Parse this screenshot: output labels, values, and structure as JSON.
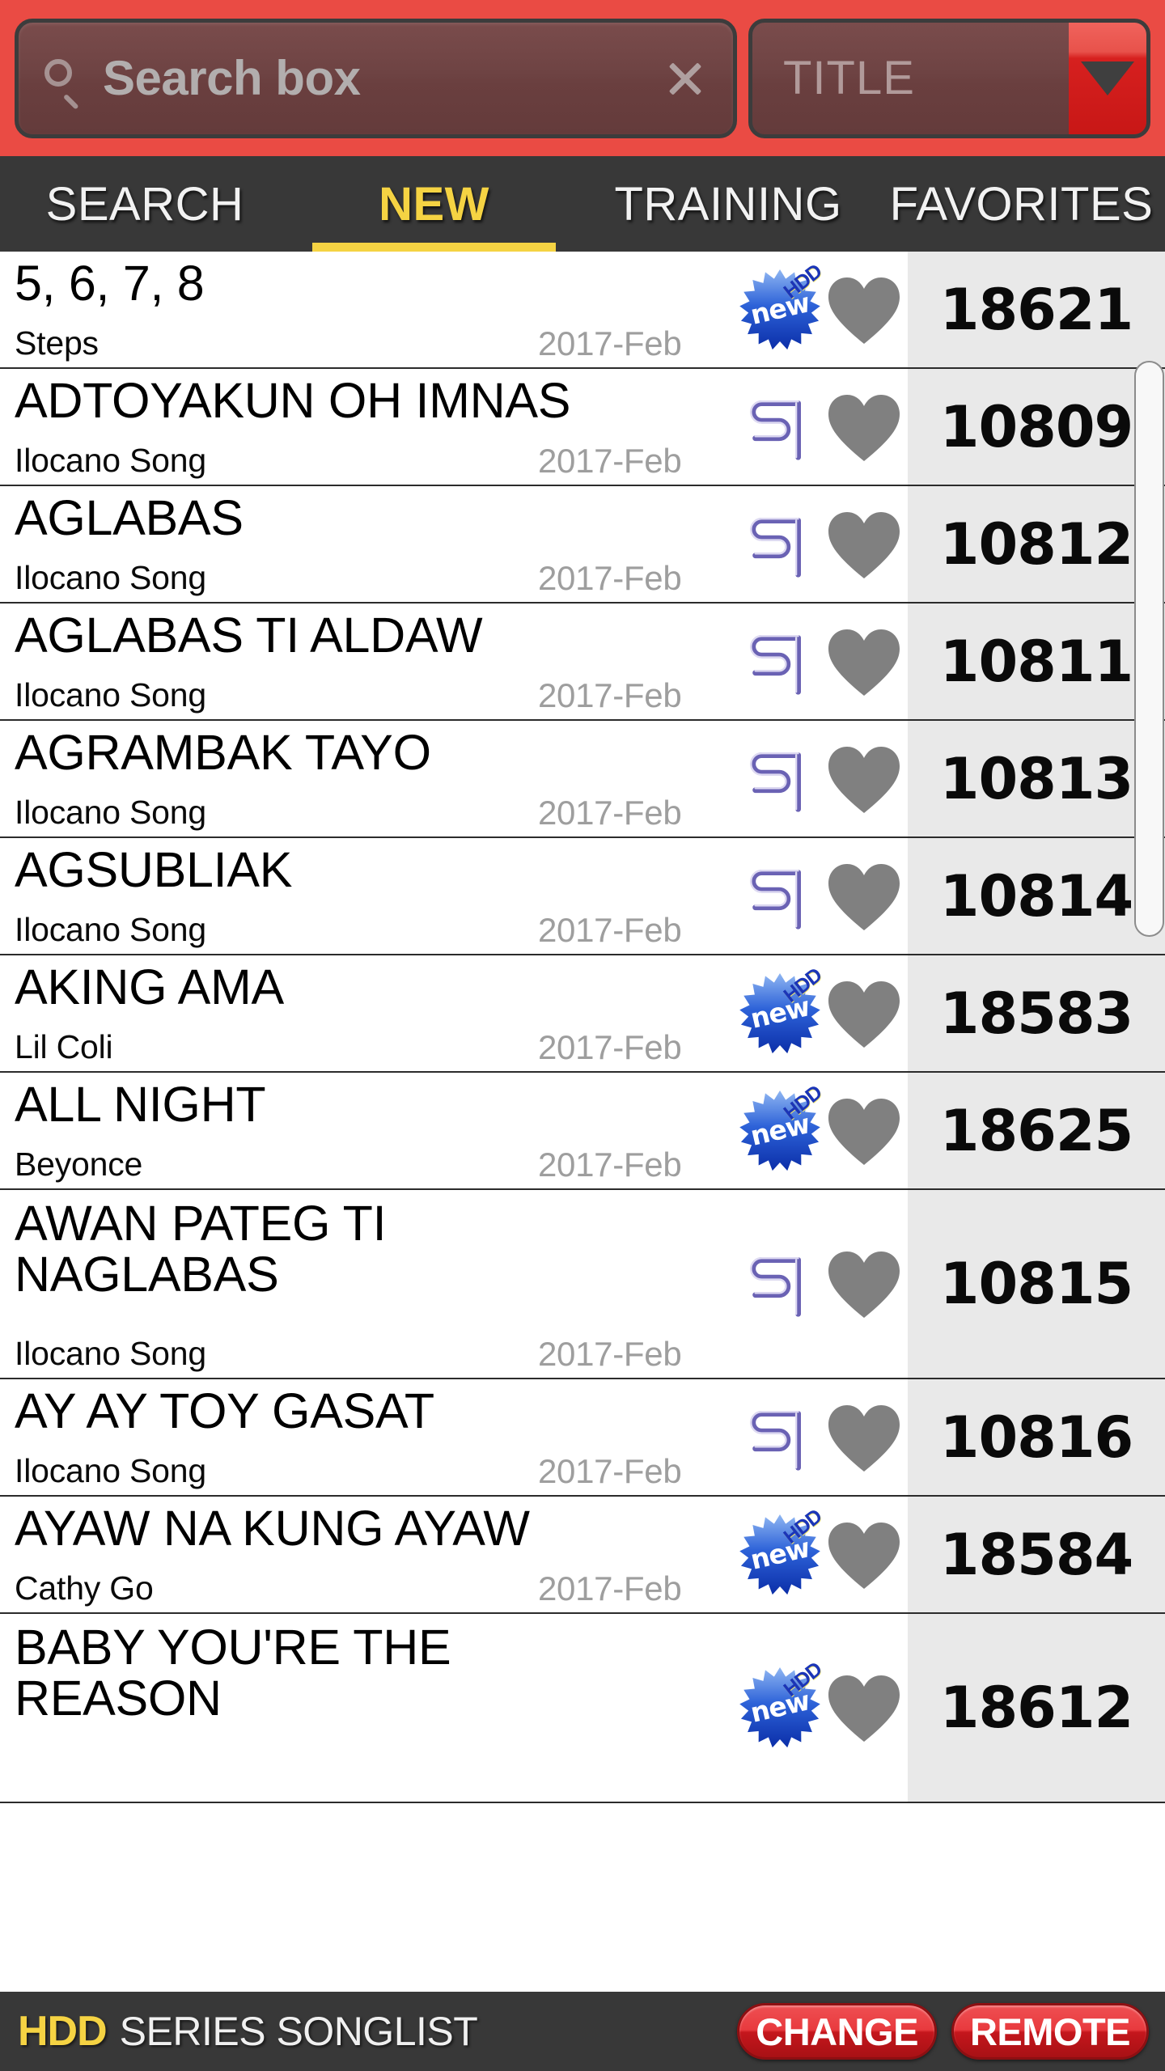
{
  "topbar": {
    "search": {
      "placeholder": "Search box",
      "value": "",
      "icon": "search-icon",
      "clear_icon": "close-icon"
    },
    "sort_dropdown": {
      "label": "TITLE",
      "caret_icon": "chevron-down-icon"
    },
    "accent_color": "#ea4b44"
  },
  "tabs": {
    "items": [
      {
        "label": "SEARCH",
        "active": false
      },
      {
        "label": "NEW",
        "active": true
      },
      {
        "label": "TRAINING",
        "active": false
      },
      {
        "label": "FAVORITES",
        "active": false
      }
    ],
    "active_color": "#f5d343",
    "bar_color": "#383838"
  },
  "list": {
    "badge_labels": {
      "new": "new",
      "hdd": "HDD"
    },
    "rows": [
      {
        "title": "5, 6, 7, 8",
        "artist": "Steps",
        "date": "2017-Feb",
        "badge": "new-hdd",
        "number": "18621",
        "lines": 1
      },
      {
        "title": "ADTOYAKUN OH IMNAS",
        "artist": "Ilocano Song",
        "date": "2017-Feb",
        "badge": "st",
        "number": "10809",
        "lines": 1
      },
      {
        "title": "AGLABAS",
        "artist": "Ilocano Song",
        "date": "2017-Feb",
        "badge": "st",
        "number": "10812",
        "lines": 1
      },
      {
        "title": "AGLABAS TI ALDAW",
        "artist": "Ilocano Song",
        "date": "2017-Feb",
        "badge": "st",
        "number": "10811",
        "lines": 1
      },
      {
        "title": "AGRAMBAK TAYO",
        "artist": "Ilocano Song",
        "date": "2017-Feb",
        "badge": "st",
        "number": "10813",
        "lines": 1
      },
      {
        "title": "AGSUBLIAK",
        "artist": "Ilocano Song",
        "date": "2017-Feb",
        "badge": "st",
        "number": "10814",
        "lines": 1
      },
      {
        "title": "AKING AMA",
        "artist": "Lil Coli",
        "date": "2017-Feb",
        "badge": "new-hdd",
        "number": "18583",
        "lines": 1
      },
      {
        "title": "ALL NIGHT",
        "artist": "Beyonce",
        "date": "2017-Feb",
        "badge": "new-hdd",
        "number": "18625",
        "lines": 1
      },
      {
        "title": "AWAN PATEG TI\nNAGLABAS",
        "artist": "Ilocano Song",
        "date": "2017-Feb",
        "badge": "st",
        "number": "10815",
        "lines": 2
      },
      {
        "title": "AY AY TOY GASAT",
        "artist": "Ilocano Song",
        "date": "2017-Feb",
        "badge": "st",
        "number": "10816",
        "lines": 1
      },
      {
        "title": "AYAW NA KUNG AYAW",
        "artist": "Cathy Go",
        "date": "2017-Feb",
        "badge": "new-hdd",
        "number": "18584",
        "lines": 1
      },
      {
        "title": "BABY YOU'RE THE\nREASON",
        "artist": "",
        "date": "",
        "badge": "new-hdd",
        "number": "18612",
        "lines": 2
      }
    ]
  },
  "bottombar": {
    "brand": "HDD",
    "brand_sub": "SERIES SONGLIST",
    "change_label": "CHANGE",
    "remote_label": "REMOTE",
    "brand_color": "#f5d343",
    "button_color": "#c4161c"
  }
}
